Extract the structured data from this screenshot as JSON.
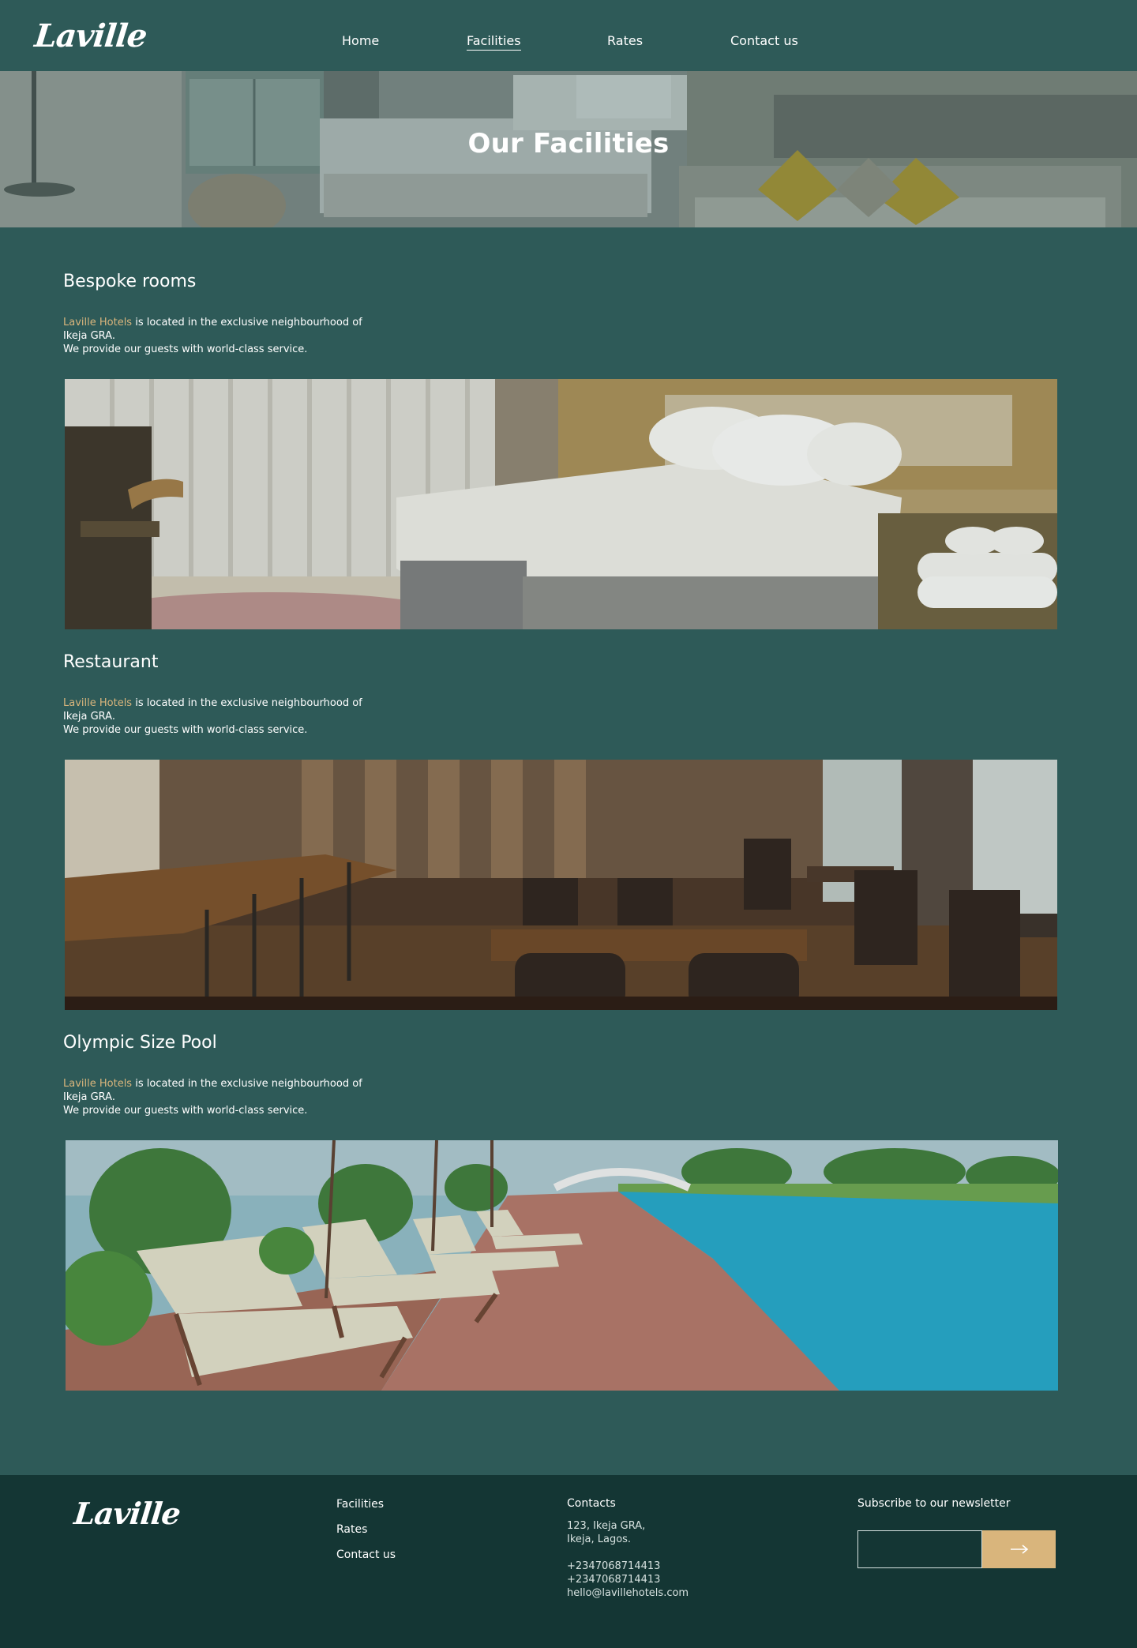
{
  "brand": {
    "logo_text": "Laville",
    "accent_color": "#d9b57c",
    "background_color": "#2e5a58",
    "footer_color": "#143634"
  },
  "nav": {
    "items": [
      {
        "label": "Home",
        "active": false
      },
      {
        "label": "Facilities",
        "active": true
      },
      {
        "label": "Rates",
        "active": false
      },
      {
        "label": "Contact us",
        "active": false
      }
    ]
  },
  "hero": {
    "title": "Our Facilities"
  },
  "sections": [
    {
      "title": "Bespoke rooms",
      "brand_text": "Laville Hotels",
      "text_line1": " is located in the exclusive neighbourhood of",
      "text_line2": "Ikeja GRA.",
      "text_line3": "We provide our guests with world-class service.",
      "image": "hotel-bedroom-photo"
    },
    {
      "title": "Restaurant",
      "brand_text": "Laville Hotels",
      "text_line1": " is located in the exclusive neighbourhood of",
      "text_line2": "Ikeja GRA.",
      "text_line3": "We provide our guests with world-class service.",
      "image": "restaurant-interior-photo"
    },
    {
      "title": "Olympic Size Pool",
      "brand_text": "Laville Hotels",
      "text_line1": " is located in the exclusive neighbourhood of",
      "text_line2": "Ikeja GRA.",
      "text_line3": "We provide our guests with world-class service.",
      "image": "pool-with-sunloungers-photo"
    }
  ],
  "footer": {
    "logo_text": "Laville",
    "links": [
      "Facilities",
      "Rates",
      "Contact us"
    ],
    "contacts_heading": "Contacts",
    "address_line1": "123, Ikeja GRA,",
    "address_line2": "Ikeja, Lagos.",
    "phone1": "+2347068714413",
    "phone2": "+2347068714413",
    "email": "hello@lavillehotels.com",
    "newsletter_heading": "Subscribe to our newsletter",
    "newsletter_placeholder": "",
    "submit_icon": "arrow-right-icon"
  }
}
